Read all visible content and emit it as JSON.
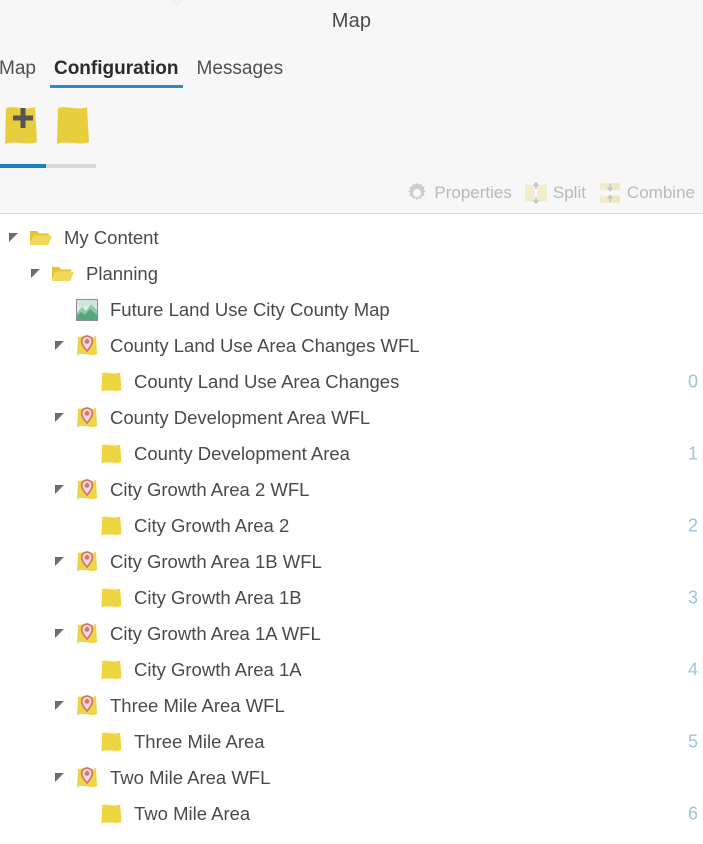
{
  "window": {
    "title": "Map",
    "ghost_icon": "gear-icon-partial"
  },
  "tabs": [
    {
      "label": "Map",
      "active": false,
      "clipped": true
    },
    {
      "label": "Configuration",
      "active": true,
      "clipped": false
    },
    {
      "label": "Messages",
      "active": false,
      "clipped": false
    }
  ],
  "gallery": {
    "items": [
      {
        "name": "new-map-sheet",
        "has_plus": true
      },
      {
        "name": "map-sheet",
        "has_plus": false
      }
    ],
    "scrollbar": {
      "thumb_percent": 48
    }
  },
  "toolbar": {
    "buttons": [
      {
        "label": "Properties",
        "icon": "gear-icon",
        "enabled": false
      },
      {
        "label": "Split",
        "icon": "split-icon",
        "enabled": false
      },
      {
        "label": "Combine",
        "icon": "combine-icon",
        "enabled": false
      }
    ]
  },
  "colors": {
    "accent_blue": "#2e8bc9",
    "progress_blue": "#1b7fc4",
    "folder_yellow": "#e8c832",
    "sheet_yellow": "#efd641",
    "pin_red": "#d9534f",
    "count_blue": "#9dc3dd",
    "panel_gray": "#f7f7f7"
  },
  "tree": {
    "rows": [
      {
        "label": "My Content",
        "indent": 0,
        "icon": "folder-open-icon",
        "expander": "open",
        "count": ""
      },
      {
        "label": "Planning",
        "indent": 1,
        "icon": "folder-open-icon",
        "expander": "open",
        "count": ""
      },
      {
        "label": "Future Land Use City County Map",
        "indent": 2,
        "icon": "map-thumbnail-icon",
        "expander": "blank",
        "count": ""
      },
      {
        "label": "County Land Use Area Changes WFL",
        "indent": 2,
        "icon": "feature-layer-pin-icon",
        "expander": "open",
        "count": ""
      },
      {
        "label": "County Land Use Area Changes",
        "indent": 3,
        "icon": "layer-sheet-icon",
        "expander": "blank",
        "count": "0"
      },
      {
        "label": "County Development Area WFL",
        "indent": 2,
        "icon": "feature-layer-pin-icon",
        "expander": "open",
        "count": ""
      },
      {
        "label": "County Development Area",
        "indent": 3,
        "icon": "layer-sheet-icon",
        "expander": "blank",
        "count": "1"
      },
      {
        "label": "City Growth Area 2 WFL",
        "indent": 2,
        "icon": "feature-layer-pin-icon",
        "expander": "open",
        "count": ""
      },
      {
        "label": "City Growth Area 2",
        "indent": 3,
        "icon": "layer-sheet-icon",
        "expander": "blank",
        "count": "2"
      },
      {
        "label": "City Growth Area 1B WFL",
        "indent": 2,
        "icon": "feature-layer-pin-icon",
        "expander": "open",
        "count": ""
      },
      {
        "label": "City Growth Area 1B",
        "indent": 3,
        "icon": "layer-sheet-icon",
        "expander": "blank",
        "count": "3"
      },
      {
        "label": "City Growth Area 1A WFL",
        "indent": 2,
        "icon": "feature-layer-pin-icon",
        "expander": "open",
        "count": ""
      },
      {
        "label": "City Growth Area 1A",
        "indent": 3,
        "icon": "layer-sheet-icon",
        "expander": "blank",
        "count": "4"
      },
      {
        "label": "Three Mile Area WFL",
        "indent": 2,
        "icon": "feature-layer-pin-icon",
        "expander": "open",
        "count": ""
      },
      {
        "label": "Three Mile Area",
        "indent": 3,
        "icon": "layer-sheet-icon",
        "expander": "blank",
        "count": "5"
      },
      {
        "label": "Two Mile Area WFL",
        "indent": 2,
        "icon": "feature-layer-pin-icon",
        "expander": "open",
        "count": ""
      },
      {
        "label": "Two Mile Area",
        "indent": 3,
        "icon": "layer-sheet-icon",
        "expander": "blank",
        "count": "6"
      }
    ]
  }
}
